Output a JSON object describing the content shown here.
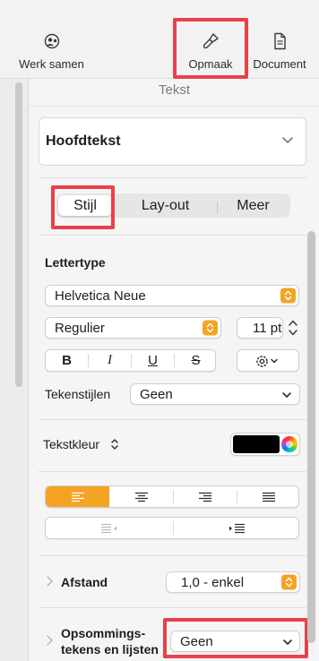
{
  "toolbar": {
    "werk_samen": "Werk samen",
    "opmaak": "Opmaak",
    "document": "Document"
  },
  "panel": {
    "title": "Tekst",
    "paragraph_style": "Hoofdtekst",
    "tabs": [
      {
        "label": "Stijl",
        "selected": true
      },
      {
        "label": "Lay-out",
        "selected": false
      },
      {
        "label": "Meer",
        "selected": false
      }
    ],
    "font": {
      "section_label": "Lettertype",
      "family": "Helvetica Neue",
      "typeface": "Regulier",
      "size": "11 pt",
      "bold": "B",
      "italic": "I",
      "underline": "U",
      "strikethrough": "S"
    },
    "character_styles": {
      "label": "Tekenstijlen",
      "value": "Geen"
    },
    "text_color": {
      "label": "Tekstkleur",
      "swatch": "#000000"
    },
    "alignment": {
      "selected": "left",
      "accent": "#f5a325"
    },
    "spacing": {
      "label": "Afstand",
      "value": "1,0 - enkel"
    },
    "bullets": {
      "label_line1": "Opsommings-",
      "label_line2": "tekens en lijsten",
      "value": "Geen"
    }
  },
  "highlight_color": "#e8414a"
}
